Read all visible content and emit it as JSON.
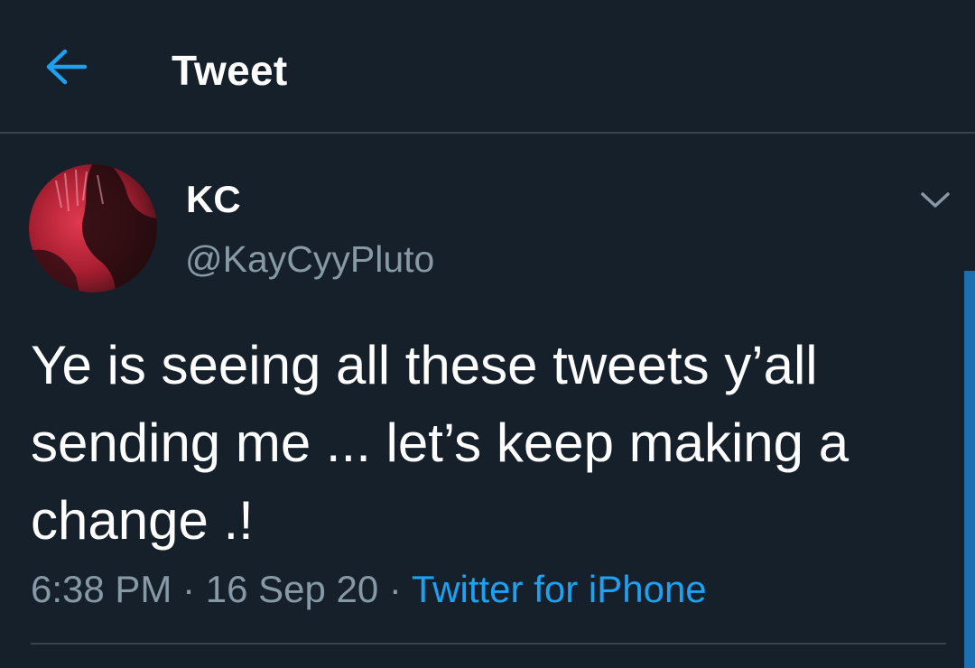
{
  "header": {
    "title": "Tweet",
    "back_icon": "arrow-left-icon"
  },
  "tweet": {
    "display_name": "KC",
    "handle": "@KayCyyPluto",
    "text": "Ye is seeing all these tweets y’all\nsending me ... let’s keep making a\nchange .!",
    "time": "6:38 PM",
    "date": "16 Sep 20",
    "separator": " · ",
    "source": "Twitter for iPhone",
    "caret_icon": "chevron-down-icon"
  },
  "colors": {
    "background": "#15202b",
    "accent": "#1da1f2",
    "muted_text": "#8899a6",
    "border": "#38444d"
  }
}
